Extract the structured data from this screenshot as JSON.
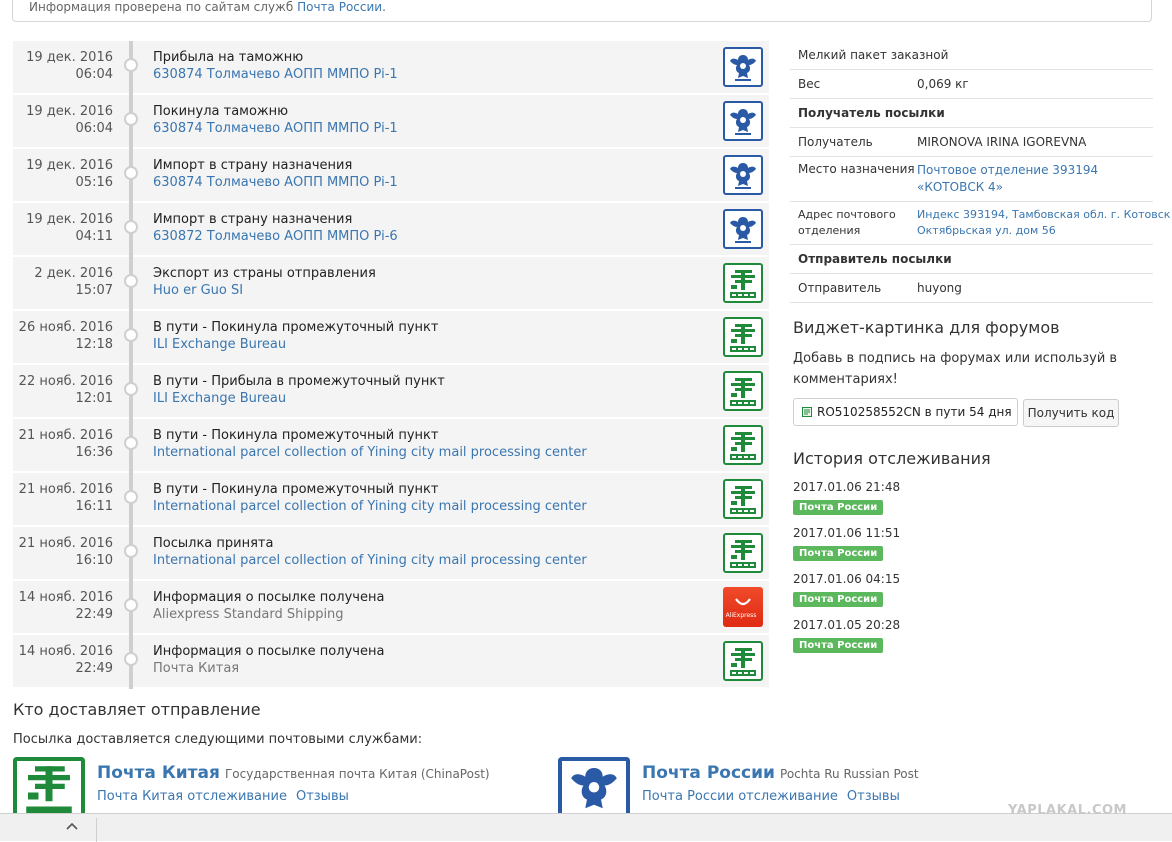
{
  "notice": {
    "text": "Информация проверена по сайтам служб",
    "link": "Почта России",
    "period": "."
  },
  "events": [
    {
      "date": "19 дек. 2016",
      "time": "06:04",
      "status": "Прибыла на таможню",
      "place": "630874 Толмачево АОПП ММПО Pi-1",
      "place_style": "link",
      "logo": "russian-post"
    },
    {
      "date": "19 дек. 2016",
      "time": "06:04",
      "status": "Покинула таможню",
      "place": "630874 Толмачево АОПП ММПО Pi-1",
      "place_style": "link",
      "logo": "russian-post"
    },
    {
      "date": "19 дек. 2016",
      "time": "05:16",
      "status": "Импорт в страну назначения",
      "place": "630874 Толмачево АОПП ММПО Pi-1",
      "place_style": "link",
      "logo": "russian-post"
    },
    {
      "date": "19 дек. 2016",
      "time": "04:11",
      "status": "Импорт в страну назначения",
      "place": "630872 Толмачево АОПП ММПО Pi-6",
      "place_style": "link",
      "logo": "russian-post"
    },
    {
      "date": "2 дек. 2016",
      "time": "15:07",
      "status": "Экспорт из страны отправления",
      "place": "Huo er Guo SI",
      "place_style": "link",
      "logo": "china-post"
    },
    {
      "date": "26 нояб. 2016",
      "time": "12:18",
      "status": "В пути - Покинула промежуточный пункт",
      "place": "ILI Exchange Bureau",
      "place_style": "link",
      "logo": "china-post"
    },
    {
      "date": "22 нояб. 2016",
      "time": "12:01",
      "status": "В пути - Прибыла в промежуточный пункт",
      "place": "ILI Exchange Bureau",
      "place_style": "link",
      "logo": "china-post"
    },
    {
      "date": "21 нояб. 2016",
      "time": "16:36",
      "status": "В пути - Покинула промежуточный пункт",
      "place": "International parcel collection of Yining city mail processing center",
      "place_style": "link",
      "logo": "china-post"
    },
    {
      "date": "21 нояб. 2016",
      "time": "16:11",
      "status": "В пути - Покинула промежуточный пункт",
      "place": "International parcel collection of Yining city mail processing center",
      "place_style": "link",
      "logo": "china-post"
    },
    {
      "date": "21 нояб. 2016",
      "time": "16:10",
      "status": "Посылка принята",
      "place": "International parcel collection of Yining city mail processing center",
      "place_style": "link",
      "logo": "china-post"
    },
    {
      "date": "14 нояб. 2016",
      "time": "22:49",
      "status": "Информация о посылке получена",
      "place": "Aliexpress Standard Shipping",
      "place_style": "muted",
      "logo": "aliexpress",
      "logo_text": "AliExpress"
    },
    {
      "date": "14 нояб. 2016",
      "time": "22:49",
      "status": "Информация о посылке получена",
      "place": "Почта Китая",
      "place_style": "muted",
      "logo": "china-post"
    }
  ],
  "details": {
    "rows": [
      {
        "type": "single",
        "text": "Мелкий пакет заказной"
      },
      {
        "type": "kv",
        "key": "Вес",
        "value": "0,069 кг"
      },
      {
        "type": "head",
        "text": "Получатель посылки"
      },
      {
        "type": "kv",
        "key": "Получатель",
        "value": "MIRONOVA IRINA IGOREVNA"
      },
      {
        "type": "kv2",
        "key": "Место назначения",
        "value1": "Почтовое отделение 393194",
        "value2": "«КОТОВСК 4»"
      },
      {
        "type": "kv3",
        "key1": "Адрес почтового",
        "key2": "отделения",
        "value1": "Индекс 393194, Тамбовская обл. г. Котовск",
        "value2": "Октябрьская ул. дом 56"
      },
      {
        "type": "head",
        "text": "Отправитель посылки"
      },
      {
        "type": "kv",
        "key": "Отправитель",
        "value": "huyong"
      }
    ]
  },
  "widget": {
    "title": "Виджет-картинка для форумов",
    "description": "Добавь в подпись на форумах или используй в комментариях!",
    "code_text": "RO510258552CN в пути 54 дня",
    "button": "Получить код"
  },
  "history": {
    "title": "История отслеживания",
    "items": [
      {
        "date": "2017.01.06 21:48",
        "source": "Почта России"
      },
      {
        "date": "2017.01.06 11:51",
        "source": "Почта России"
      },
      {
        "date": "2017.01.06 04:15",
        "source": "Почта России"
      },
      {
        "date": "2017.01.05 20:28",
        "source": "Почта России"
      }
    ],
    "badge_color": "#5cb85c"
  },
  "carriers": {
    "title": "Кто доставляет отправление",
    "description": "Посылка доставляется следующими почтовыми службами:",
    "list": [
      {
        "name": "Почта Китая",
        "subtitle": "Государственная почта Китая (ChinaPost)",
        "track_link": "Почта Китая отслеживание",
        "reviews_link": "Отзывы",
        "logo": "china-post"
      },
      {
        "name": "Почта России",
        "subtitle": "Pochta Ru Russian Post",
        "track_link": "Почта России отслеживание",
        "reviews_link": "Отзывы",
        "logo": "russian-post"
      }
    ]
  },
  "watermark": "YAPLAKAL.COM",
  "colors": {
    "link": "#3a76b0",
    "china_green": "#1f8a3a",
    "russia_blue": "#2a5aa6",
    "aliexpress_red": "#e8391c"
  }
}
